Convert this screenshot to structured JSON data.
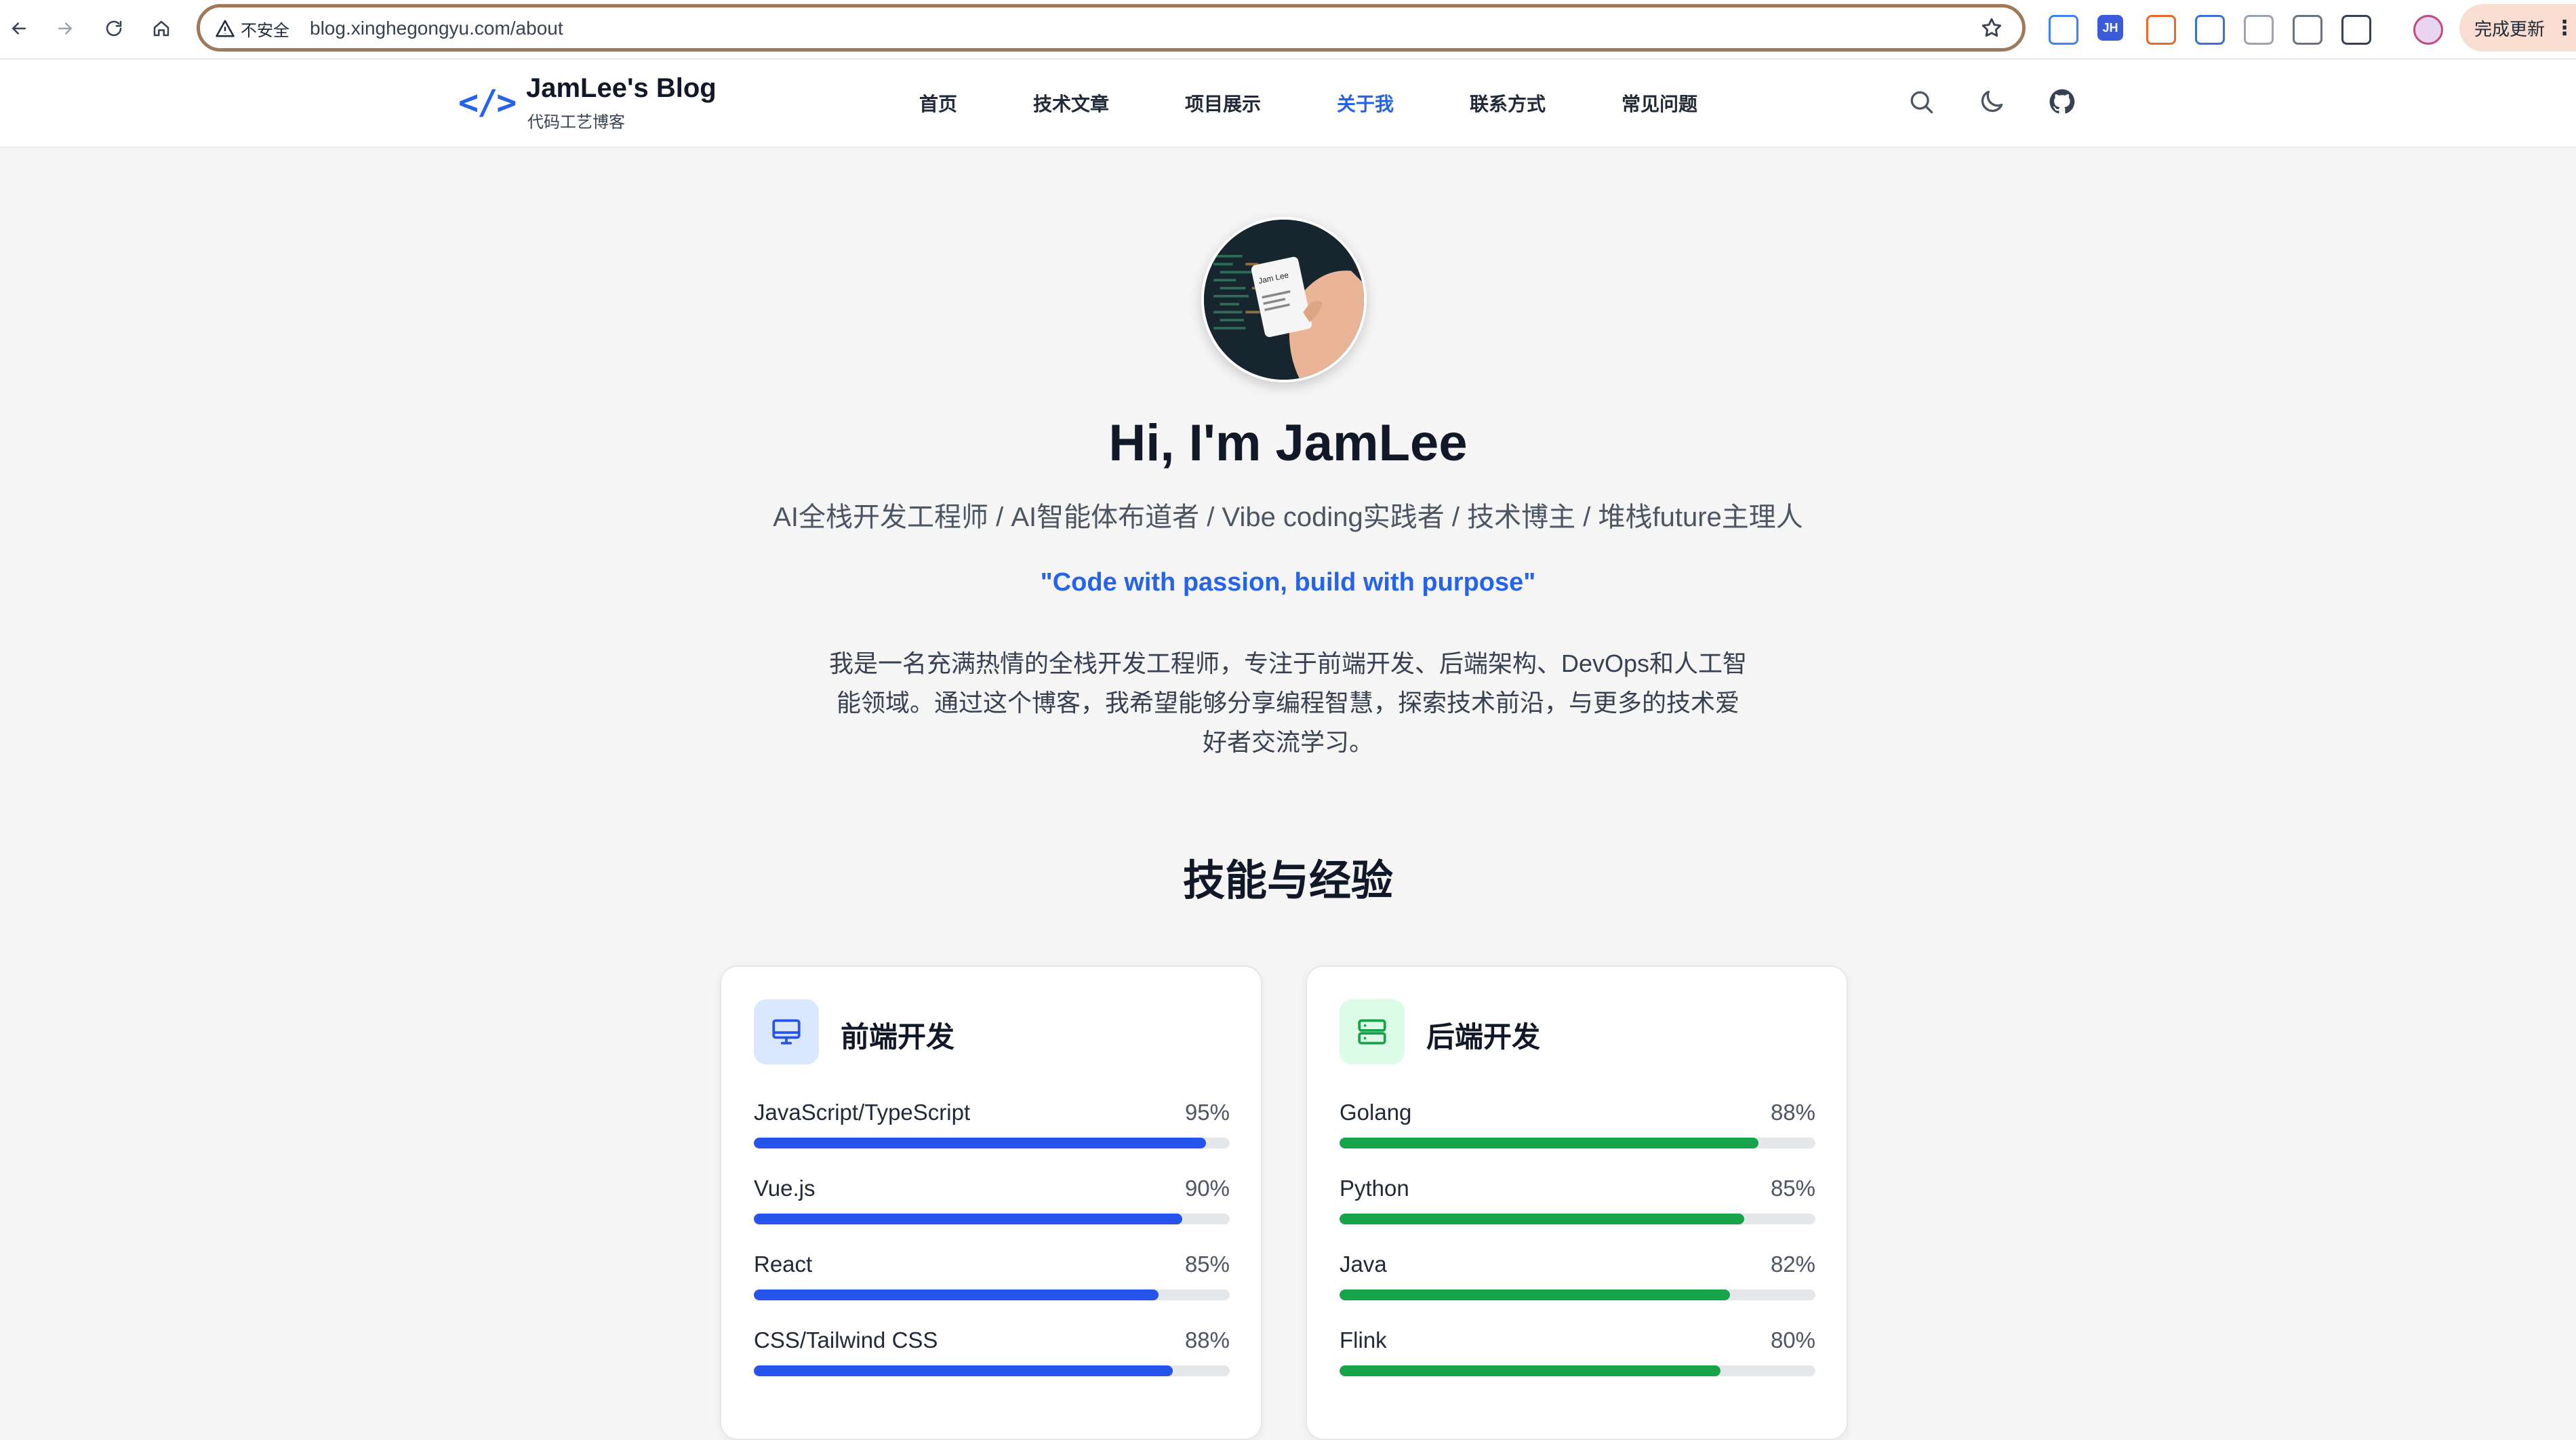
{
  "browser": {
    "security_label": "不安全",
    "url": "blog.xinghegongyu.com/about",
    "update_label": "完成更新",
    "menu_glyph": "⋮",
    "extensions": [
      {
        "name": "ext-1",
        "text": "",
        "color": "#3b82f6"
      },
      {
        "name": "ext-jh",
        "text": "JH",
        "color": "#3b5bdb"
      },
      {
        "name": "ext-3",
        "text": "",
        "color": "#e86a2b"
      },
      {
        "name": "ext-4",
        "text": "",
        "color": "#3b6fe0"
      },
      {
        "name": "ext-5",
        "text": "",
        "color": "#9ca3af"
      },
      {
        "name": "ext-6",
        "text": "",
        "color": "#6b7280"
      },
      {
        "name": "ext-7",
        "text": "",
        "color": "#374151"
      }
    ]
  },
  "site": {
    "logo_mark": "</>",
    "title": "JamLee's Blog",
    "subtitle": "代码工艺博客",
    "nav": [
      {
        "label": "首页",
        "active": false
      },
      {
        "label": "技术文章",
        "active": false
      },
      {
        "label": "项目展示",
        "active": false
      },
      {
        "label": "关于我",
        "active": true
      },
      {
        "label": "联系方式",
        "active": false
      },
      {
        "label": "常见问题",
        "active": false
      }
    ]
  },
  "hero": {
    "avatar_text": "Jam Lee",
    "greeting": "Hi, I'm JamLee",
    "roles": "AI全栈开发工程师 / AI智能体布道者 / Vibe coding实践者 / 技术博主 / 堆栈future主理人",
    "quote": "\"Code with passion, build with purpose\"",
    "bio": "我是一名充满热情的全栈开发工程师，专注于前端开发、后端架构、DevOps和人工智能领域。通过这个博客，我希望能够分享编程智慧，探索技术前沿，与更多的技术爱好者交流学习。"
  },
  "skills": {
    "section_title": "技能与经验",
    "cards": [
      {
        "title": "前端开发",
        "icon": "monitor-icon",
        "accent": "#2554eb",
        "icon_bg": "#dbe7fe",
        "items": [
          {
            "name": "JavaScript/TypeScript",
            "percent": "95%",
            "value": 95
          },
          {
            "name": "Vue.js",
            "percent": "90%",
            "value": 90
          },
          {
            "name": "React",
            "percent": "85%",
            "value": 85
          },
          {
            "name": "CSS/Tailwind CSS",
            "percent": "88%",
            "value": 88
          }
        ]
      },
      {
        "title": "后端开发",
        "icon": "server-icon",
        "accent": "#16a34a",
        "icon_bg": "#dcfce7",
        "items": [
          {
            "name": "Golang",
            "percent": "88%",
            "value": 88
          },
          {
            "name": "Python",
            "percent": "85%",
            "value": 85
          },
          {
            "name": "Java",
            "percent": "82%",
            "value": 82
          },
          {
            "name": "Flink",
            "percent": "80%",
            "value": 80
          }
        ]
      }
    ]
  }
}
